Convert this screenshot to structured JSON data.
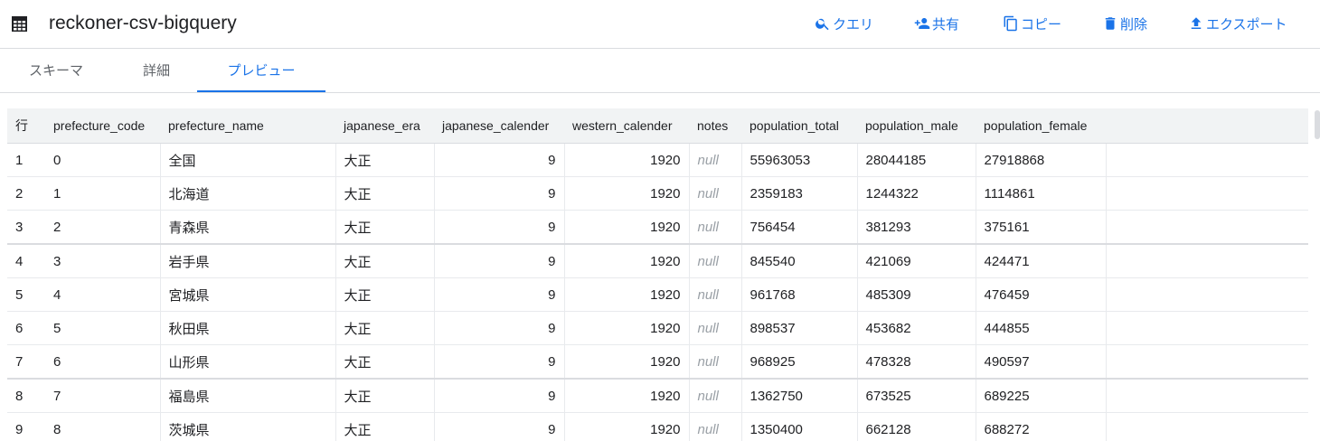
{
  "header": {
    "title": "reckoner-csv-bigquery",
    "actions": [
      {
        "label": "クエリ",
        "icon": "search-icon"
      },
      {
        "label": "共有",
        "icon": "person-add-icon"
      },
      {
        "label": "コピー",
        "icon": "copy-icon"
      },
      {
        "label": "削除",
        "icon": "delete-icon"
      },
      {
        "label": "エクスポート",
        "icon": "upload-icon"
      }
    ]
  },
  "tabs": [
    {
      "label": "スキーマ",
      "active": false
    },
    {
      "label": "詳細",
      "active": false
    },
    {
      "label": "プレビュー",
      "active": true
    }
  ],
  "colors": {
    "accent": "#1a73e8",
    "header_bg": "#f1f3f4",
    "null_text": "#9aa0a6"
  },
  "table": {
    "columns": [
      "行",
      "prefecture_code",
      "prefecture_name",
      "japanese_era",
      "japanese_calender",
      "western_calender",
      "notes",
      "population_total",
      "population_male",
      "population_female"
    ],
    "rows": [
      [
        "1",
        "0",
        "全国",
        "大正",
        "9",
        "1920",
        "null",
        "55963053",
        "28044185",
        "27918868"
      ],
      [
        "2",
        "1",
        "北海道",
        "大正",
        "9",
        "1920",
        "null",
        "2359183",
        "1244322",
        "1114861"
      ],
      [
        "3",
        "2",
        "青森県",
        "大正",
        "9",
        "1920",
        "null",
        "756454",
        "381293",
        "375161"
      ],
      [
        "4",
        "3",
        "岩手県",
        "大正",
        "9",
        "1920",
        "null",
        "845540",
        "421069",
        "424471"
      ],
      [
        "5",
        "4",
        "宮城県",
        "大正",
        "9",
        "1920",
        "null",
        "961768",
        "485309",
        "476459"
      ],
      [
        "6",
        "5",
        "秋田県",
        "大正",
        "9",
        "1920",
        "null",
        "898537",
        "453682",
        "444855"
      ],
      [
        "7",
        "6",
        "山形県",
        "大正",
        "9",
        "1920",
        "null",
        "968925",
        "478328",
        "490597"
      ],
      [
        "8",
        "7",
        "福島県",
        "大正",
        "9",
        "1920",
        "null",
        "1362750",
        "673525",
        "689225"
      ],
      [
        "9",
        "8",
        "茨城県",
        "大正",
        "9",
        "1920",
        "null",
        "1350400",
        "662128",
        "688272"
      ]
    ]
  }
}
